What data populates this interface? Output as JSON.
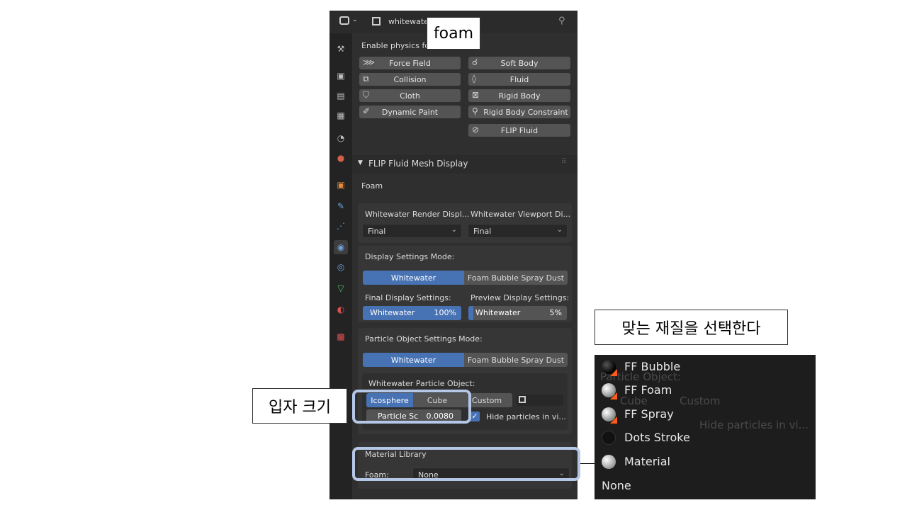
{
  "header": {
    "object_name": "whitewater",
    "pin": "pin-icon"
  },
  "physics": {
    "enable_label": "Enable physics for:",
    "buttons": {
      "force_field": "Force Field",
      "soft_body": "Soft Body",
      "collision": "Collision",
      "fluid": "Fluid",
      "cloth": "Cloth",
      "rigid_body": "Rigid Body",
      "dynamic_paint": "Dynamic Paint",
      "rigid_body_constraint": "Rigid Body Constraint",
      "flip_fluid": "FLIP Fluid"
    }
  },
  "mesh_display": {
    "panel_title": "FLIP Fluid Mesh Display",
    "section": "Foam",
    "render_display_label": "Whitewater Render Displ...",
    "viewport_display_label": "Whitewater Viewport Di...",
    "render_display_value": "Final",
    "viewport_display_value": "Final",
    "display_settings_mode": "Display Settings Mode:",
    "mode_whitewater": "Whitewater",
    "mode_fbsd": "Foam Bubble Spray Dust",
    "final_display_settings": "Final Display Settings:",
    "preview_display_settings": "Preview Display Settings:",
    "final_slider": {
      "label": "Whitewater",
      "value_text": "100%",
      "value": 1.0
    },
    "preview_slider": {
      "label": "Whitewater",
      "value_text": "5%",
      "value": 0.05
    },
    "particle_object_settings_mode": "Particle Object Settings Mode:",
    "particle_mode_whitewater": "Whitewater",
    "particle_mode_fbsd": "Foam Bubble Spray Dust",
    "whitewater_particle_object": "Whitewater Particle Object:",
    "shape_icosphere": "Icosphere",
    "shape_cube": "Cube",
    "shape_custom": "Custom",
    "particle_scale_label": "Particle Sc",
    "particle_scale_value": "0.0080",
    "hide_particles": "Hide particles in vi...",
    "material_library": "Material Library",
    "foam_label": "Foam:",
    "foam_value": "None"
  },
  "callouts": {
    "foam": "foam",
    "particle_size": "입자 크기",
    "choose_material": "맞는 재질을 선택한다"
  },
  "material_menu": {
    "items": [
      "FF Bubble",
      "FF Foam",
      "FF Spray",
      "Dots Stroke",
      "Material"
    ],
    "none": "None",
    "ghost_object": "Particle Object:",
    "ghost_custom": "Custom",
    "ghost_hide": "Hide particles in vi...",
    "ghost_cube": "Cube"
  },
  "colors": {
    "accent": "#4772b3",
    "highlight": "#b4c7e7"
  }
}
